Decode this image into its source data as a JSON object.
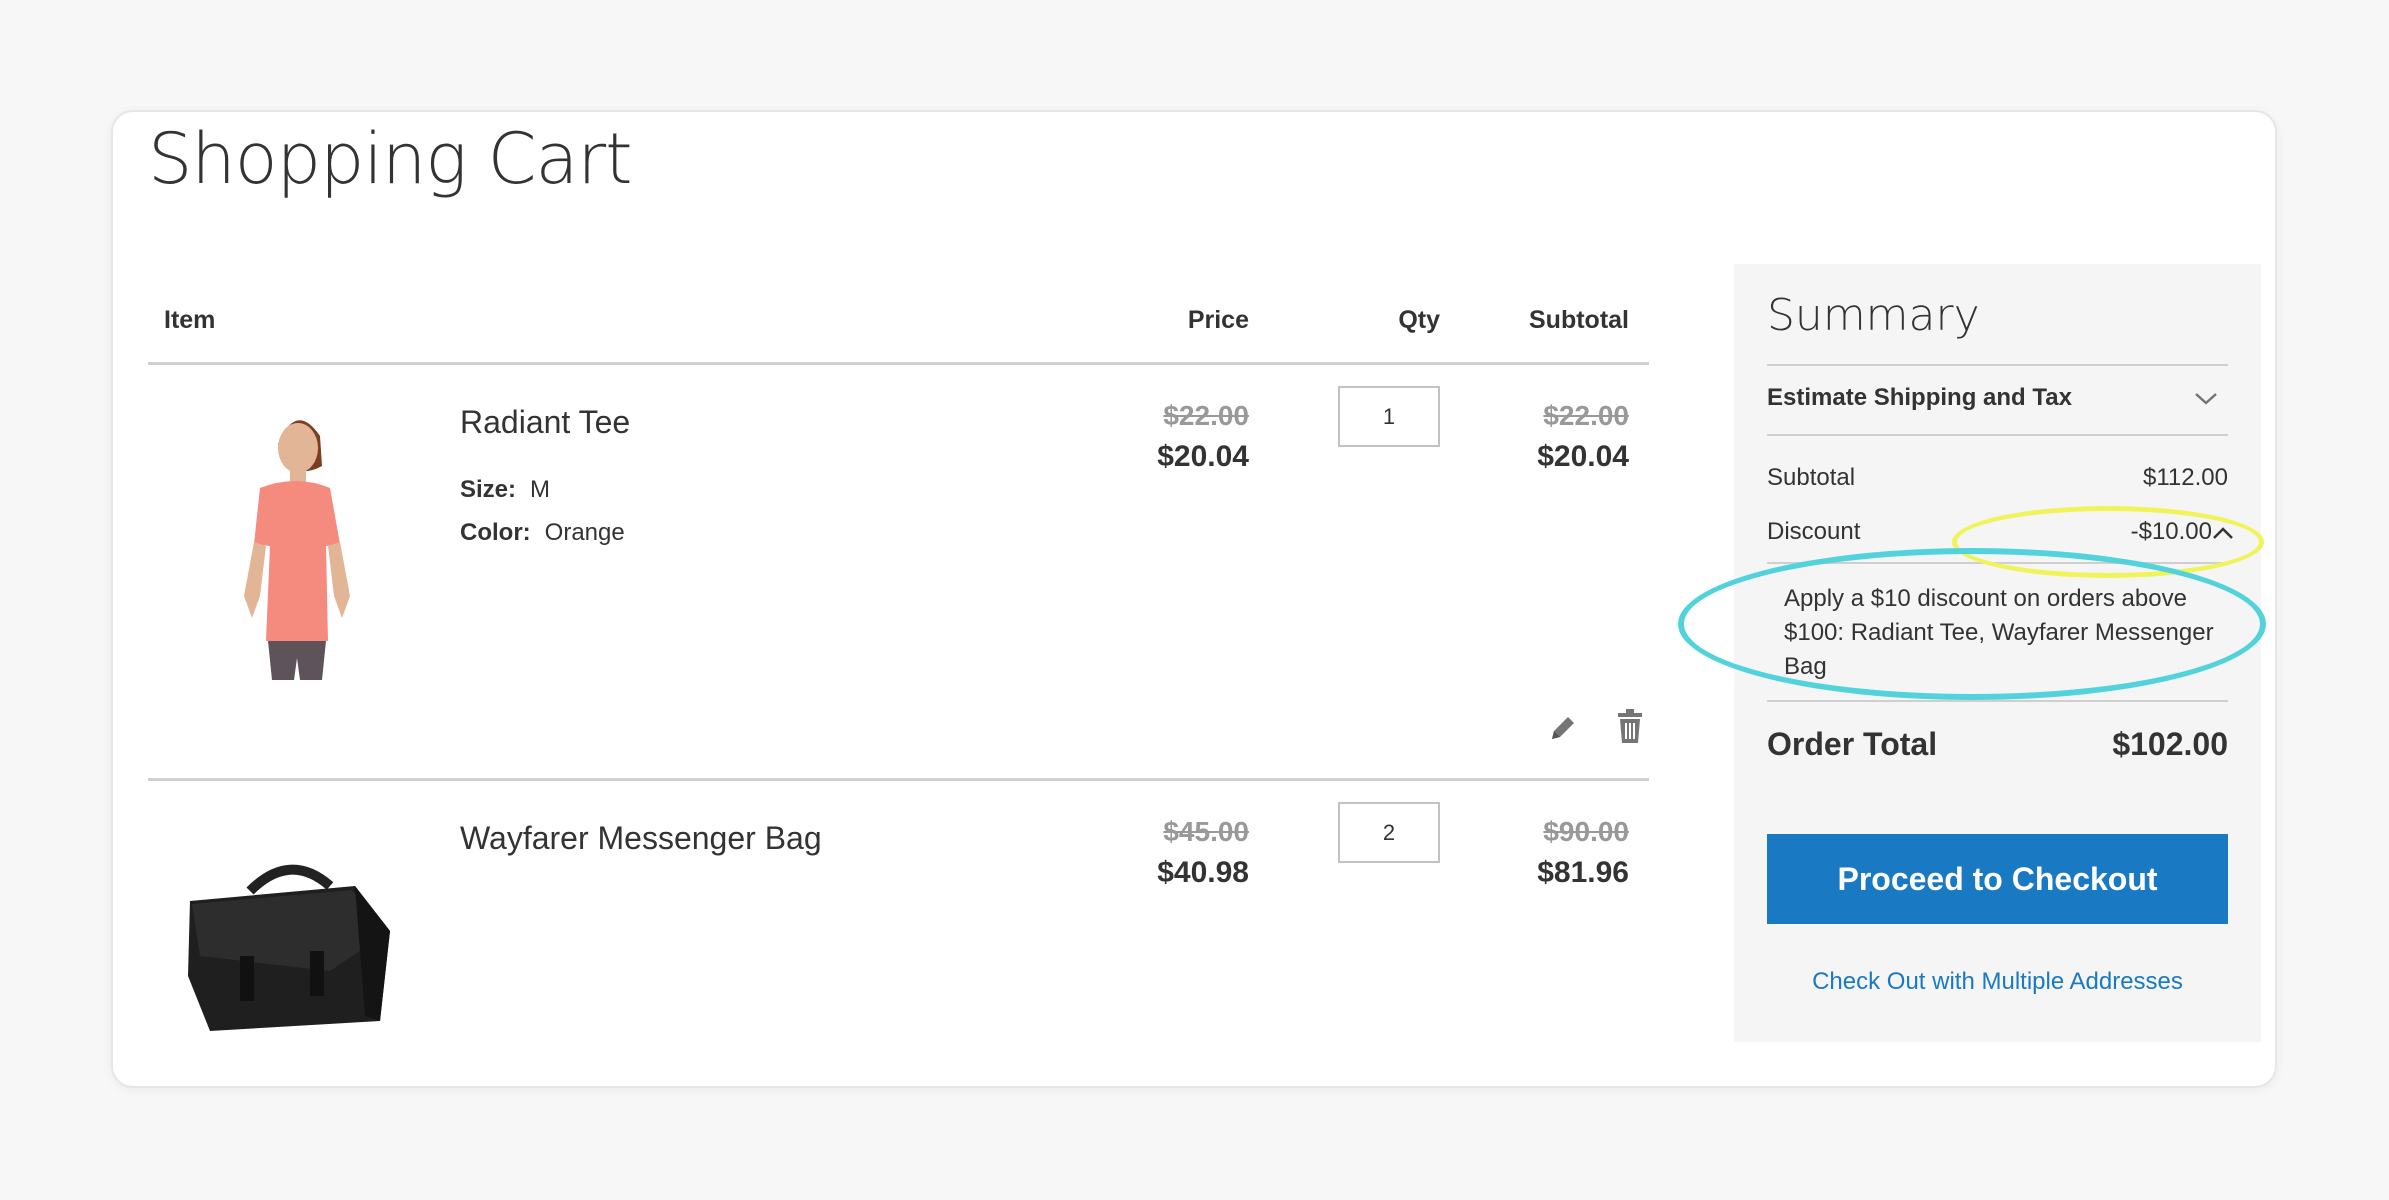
{
  "page": {
    "title": "Shopping Cart"
  },
  "table": {
    "headers": {
      "item": "Item",
      "price": "Price",
      "qty": "Qty",
      "subtotal": "Subtotal"
    }
  },
  "items": [
    {
      "name": "Radiant Tee",
      "options": [
        {
          "label": "Size:",
          "value": "M"
        },
        {
          "label": "Color:",
          "value": "Orange"
        }
      ],
      "price_old": "$22.00",
      "price_new": "$20.04",
      "qty": "1",
      "subtotal_old": "$22.00",
      "subtotal_new": "$20.04"
    },
    {
      "name": "Wayfarer Messenger Bag",
      "options": [],
      "price_old": "$45.00",
      "price_new": "$40.98",
      "qty": "2",
      "subtotal_old": "$90.00",
      "subtotal_new": "$81.96"
    }
  ],
  "summary": {
    "title": "Summary",
    "estimate_label": "Estimate Shipping and Tax",
    "subtotal_label": "Subtotal",
    "subtotal_value": "$112.00",
    "discount_label": "Discount",
    "discount_value": "-$10.00",
    "discount_rule": "Apply a $10 discount on orders above $100: Radiant Tee, Wayfarer Messenger Bag",
    "order_total_label": "Order Total",
    "order_total_value": "$102.00",
    "checkout_label": "Proceed to Checkout",
    "multi_address_label": "Check Out with Multiple Addresses"
  },
  "icons": {
    "edit": "pencil-icon",
    "delete": "trash-icon",
    "estimate_toggle": "chevron-down-icon",
    "discount_toggle": "chevron-up-icon"
  },
  "colors": {
    "primary": "#1979c3",
    "highlight_yellow": "#f0f45a",
    "highlight_cyan": "#52d3dc"
  }
}
